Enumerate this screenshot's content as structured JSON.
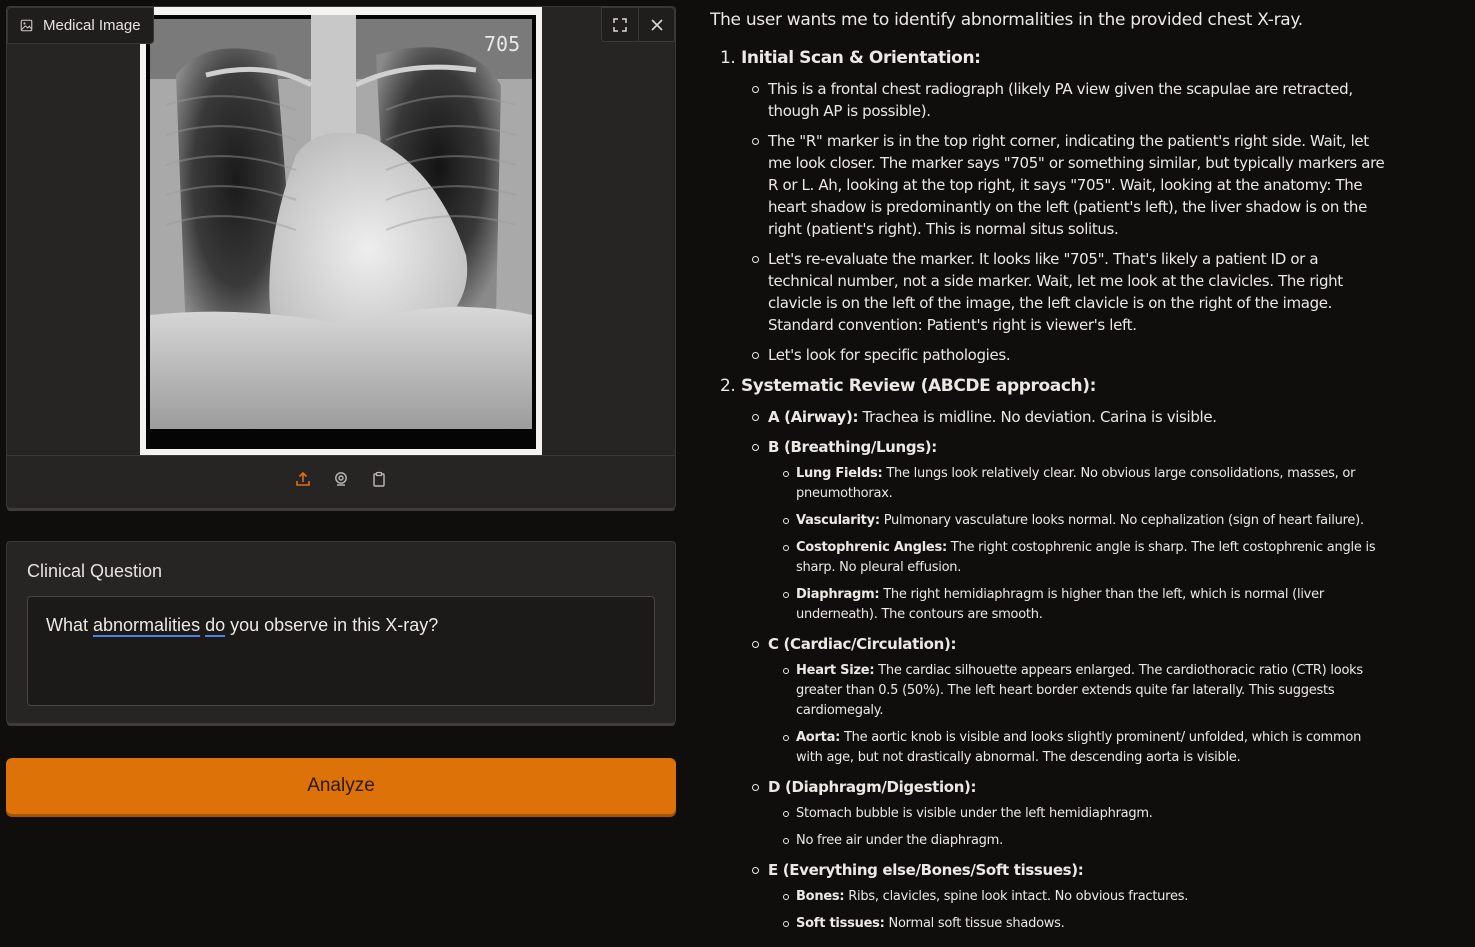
{
  "image_panel": {
    "label": "Medical Image",
    "marker_text": "705",
    "toolbar": [
      "fullscreen-icon",
      "close-icon"
    ],
    "source_icons": [
      "upload-icon",
      "webcam-icon",
      "clipboard-icon"
    ],
    "accent": "#dc7208"
  },
  "question": {
    "label": "Clinical Question",
    "value_parts": [
      "What ",
      "abnormalities",
      " ",
      "do",
      " you observe in this X-ray?"
    ]
  },
  "analyze": {
    "label": "Analyze"
  },
  "response": {
    "intro": "The user wants me to identify abnormalities in the provided chest X-ray.",
    "sections": [
      {
        "num": "1.",
        "title": "Initial Scan & Orientation:",
        "items": [
          "This is a frontal chest radiograph (likely PA view given the scapulae are retracted, though AP is possible).",
          "The \"R\" marker is in the top right corner, indicating the patient's right side. Wait, let me look closer. The marker says \"705\" or something similar, but typically markers are R or L. Ah, looking at the top right, it says \"705\". Wait, looking at the anatomy: The heart shadow is predominantly on the left (patient's left), the liver shadow is on the right (patient's right). This is normal situs solitus.",
          "Let's re-evaluate the marker. It looks like \"705\". That's likely a patient ID or a technical number, not a side marker. Wait, let me look at the clavicles. The right clavicle is on the left of the image, the left clavicle is on the right of the image. Standard convention: Patient's right is viewer's left.",
          "Let's look for specific pathologies."
        ]
      },
      {
        "num": "2.",
        "title": "Systematic Review (ABCDE approach):",
        "items": [
          {
            "head": "A (Airway):",
            "text": " Trachea is midline. No deviation. Carina is visible.",
            "sub": []
          },
          {
            "head": "B (Breathing/Lungs):",
            "text": "",
            "sub": [
              {
                "head": "Lung Fields:",
                "text": " The lungs look relatively clear. No obvious large consolidations, masses, or pneumothorax."
              },
              {
                "head": "Vascularity:",
                "text": " Pulmonary vasculature looks normal. No cephalization (sign of heart failure)."
              },
              {
                "head": "Costophrenic Angles:",
                "text": " The right costophrenic angle is sharp. The left costophrenic angle is sharp. No pleural effusion."
              },
              {
                "head": "Diaphragm:",
                "text": " The right hemidiaphragm is higher than the left, which is normal (liver underneath). The contours are smooth."
              }
            ]
          },
          {
            "head": "C (Cardiac/Circulation):",
            "text": "",
            "sub": [
              {
                "head": "Heart Size:",
                "text": " The cardiac silhouette appears enlarged. The cardiothoracic ratio (CTR) looks greater than 0.5 (50%). The left heart border extends quite far laterally. This suggests cardiomegaly."
              },
              {
                "head": "Aorta:",
                "text": " The aortic knob is visible and looks slightly prominent/ unfolded, which is common with age, but not drastically abnormal. The descending aorta is visible."
              }
            ]
          },
          {
            "head": "D (Diaphragm/Digestion):",
            "text": "",
            "sub": [
              {
                "head": "",
                "text": "Stomach bubble is visible under the left hemidiaphragm."
              },
              {
                "head": "",
                "text": "No free air under the diaphragm."
              }
            ]
          },
          {
            "head": "E (Everything else/Bones/Soft tissues):",
            "text": "",
            "sub": [
              {
                "head": "Bones:",
                "text": " Ribs, clavicles, spine look intact. No obvious fractures."
              },
              {
                "head": "Soft tissues:",
                "text": " Normal soft tissue shadows."
              }
            ]
          }
        ]
      }
    ]
  }
}
